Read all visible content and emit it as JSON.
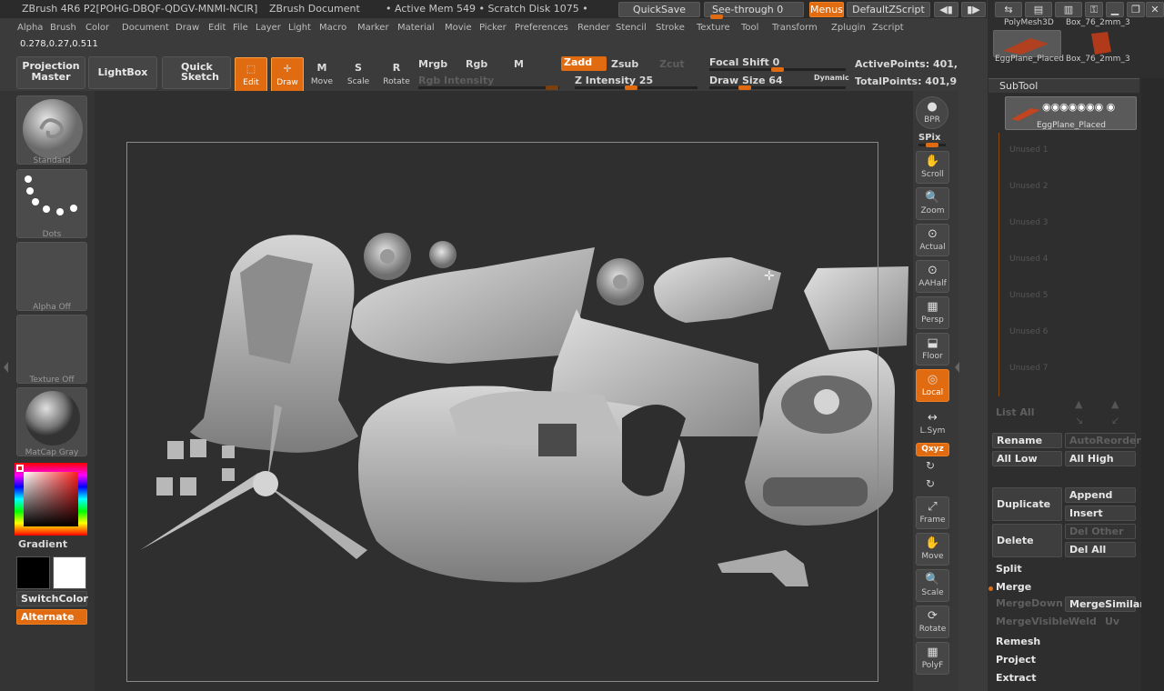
{
  "titlebar": {
    "app": "ZBrush 4R6 P2[POHG-DBQF-QDGV-MNMI-NCIR]",
    "document": "ZBrush Document",
    "mem": "• Active Mem 549 • Scratch Disk 1075 •",
    "quicksave": "QuickSave",
    "seethrough": "See-through 0",
    "menus": "Menus",
    "zscript": "DefaultZScript"
  },
  "menu": [
    "Alpha",
    "Brush",
    "Color",
    "Document",
    "Draw",
    "Edit",
    "File",
    "Layer",
    "Light",
    "Macro",
    "Marker",
    "Material",
    "Movie",
    "Picker",
    "Preferences",
    "Render",
    "Stencil",
    "Stroke",
    "Texture",
    "Tool",
    "Transform",
    "Zplugin",
    "Zscript"
  ],
  "coords": "0.278,0.27,0.511",
  "toolbar": {
    "projection": "Projection Master",
    "lightbox": "LightBox",
    "quicksketch": "Quick Sketch",
    "edit": "Edit",
    "draw": "Draw",
    "move": "Move",
    "scale": "Scale",
    "rotate": "Rotate",
    "mrgb": "Mrgb",
    "rgb": "Rgb",
    "m": "M",
    "rgb_intensity": "Rgb Intensity",
    "zadd": "Zadd",
    "zsub": "Zsub",
    "zcut": "Zcut",
    "z_intensity": "Z Intensity 25",
    "focal_shift": "Focal Shift 0",
    "draw_size": "Draw Size 64",
    "dynamic": "Dynamic",
    "active_points": "ActivePoints: 401,",
    "total_points": "TotalPoints: 401,9"
  },
  "left": {
    "brush": "Standard",
    "stroke": "Dots",
    "alpha": "Alpha Off",
    "texture": "Texture Off",
    "material": "MatCap Gray",
    "gradient": "Gradient",
    "switchcolor": "SwitchColor",
    "alternate": "Alternate"
  },
  "right": {
    "bpr": "BPR",
    "spix": "SPix",
    "scroll": "Scroll",
    "zoom": "Zoom",
    "actual": "Actual",
    "aahalf": "AAHalf",
    "persp": "Persp",
    "floor": "Floor",
    "local": "Local",
    "lsym": "L.Sym",
    "xyz": "Qxyz",
    "frame": "Frame",
    "move": "Move",
    "scale": "Scale",
    "rotate": "Rotate",
    "polyf": "PolyF"
  },
  "panel": {
    "thumb1": "PolyMesh3D",
    "thumb2": "Box_76_2mm_3",
    "thumb3": "EggPlane_Placed",
    "thumb4": "Box_76_2mm_3",
    "subtool": "SubTool",
    "selected": "EggPlane_Placed",
    "unused": [
      "Unused 1",
      "Unused 2",
      "Unused 3",
      "Unused 4",
      "Unused 5",
      "Unused 6",
      "Unused 7"
    ],
    "listall": "List All",
    "rename": "Rename",
    "autoreorder": "AutoReorder",
    "alllow": "All Low",
    "allhigh": "All High",
    "duplicate": "Duplicate",
    "append": "Append",
    "insert": "Insert",
    "delete": "Delete",
    "delother": "Del Other",
    "delall": "Del All",
    "split": "Split",
    "merge": "Merge",
    "mergedown": "MergeDown",
    "mergesimilar": "MergeSimilar",
    "mergevisible": "MergeVisible",
    "weld": "Weld",
    "uv": "Uv",
    "remesh": "Remesh",
    "project": "Project",
    "extract": "Extract"
  },
  "colors": {
    "accent": "#e06b10",
    "primary": "#111111",
    "secondary": "#ffffff"
  }
}
